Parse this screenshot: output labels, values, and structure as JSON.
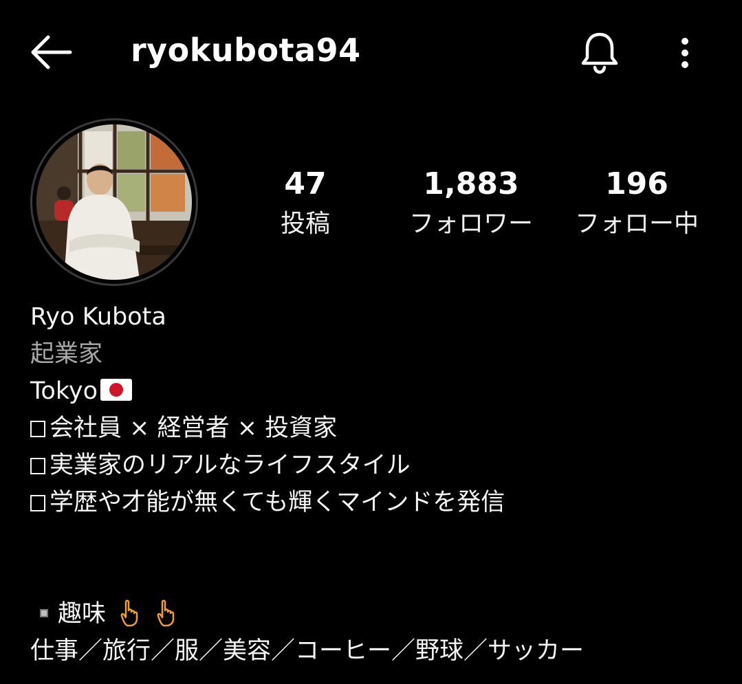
{
  "header": {
    "username": "ryokubota94"
  },
  "stats": {
    "posts": {
      "value": "47",
      "label": "投稿"
    },
    "followers": {
      "value": "1,883",
      "label": "フォロワー"
    },
    "following": {
      "value": "196",
      "label": "フォロー中"
    }
  },
  "bio": {
    "name": "Ryo Kubota",
    "category": "起業家",
    "location": "Tokyo",
    "line1": "会社員 × 経営者 × 投資家",
    "line2": "実業家のリアルなライフスタイル",
    "line3": "学歴や才能が無くても輝くマインドを発信",
    "hobby_label": "趣味",
    "hobbies": "仕事／旅行／服／美容／コーヒー／野球／サッカー"
  },
  "icons": {
    "back": "back-arrow-icon",
    "bell": "bell-icon",
    "more": "more-vertical-icon",
    "flag": "japan-flag-icon",
    "hand": "pointing-down-hand-icon"
  },
  "colors": {
    "background": "#000000",
    "text": "#f5f5f5",
    "secondary_text": "#a8a8a8",
    "emoji_hand": "#f0a030",
    "flag_red": "#d0152a"
  }
}
